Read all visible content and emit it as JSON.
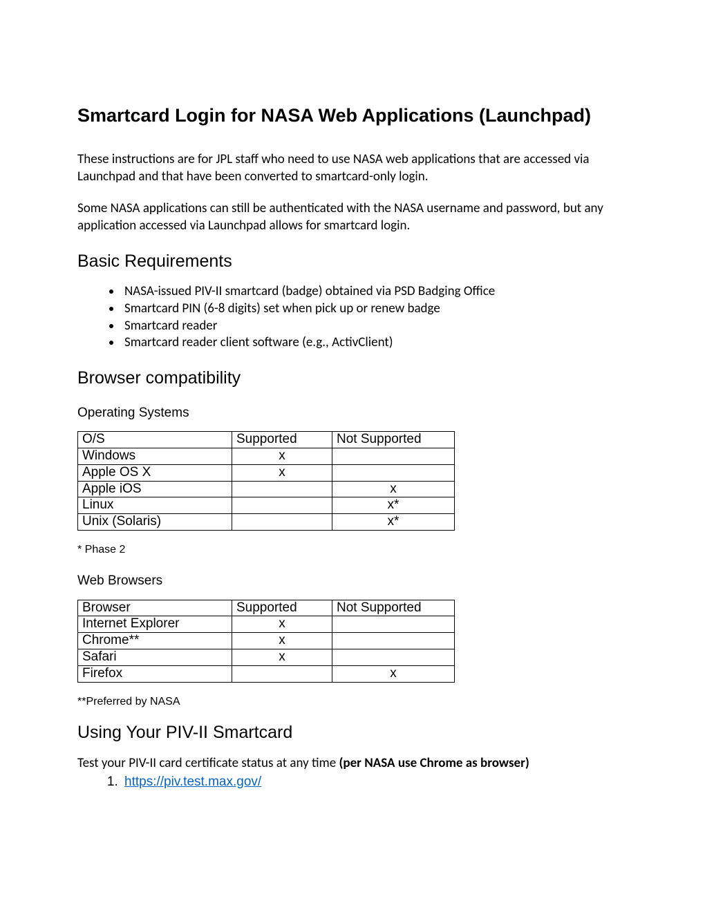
{
  "title": "Smartcard Login for NASA Web Applications (Launchpad)",
  "intro": {
    "p1": "These instructions are for JPL staff who need to use NASA web applications that are accessed via Launchpad and that have been converted to smartcard-only login.",
    "p2": "Some NASA applications can still be authenticated with the NASA username and password, but any application accessed via Launchpad allows for smartcard login."
  },
  "basic": {
    "heading": "Basic Requirements",
    "items": [
      "NASA-issued PIV-II smartcard (badge) obtained via PSD Badging Office",
      "Smartcard PIN (6-8 digits) set when pick up or renew badge",
      "Smartcard reader",
      "Smartcard reader client software (e.g., ActivClient)"
    ]
  },
  "compat": {
    "heading": "Browser compatibility",
    "os": {
      "subheading": "Operating Systems",
      "headers": {
        "c0": "O/S",
        "c1": "Supported",
        "c2": "Not Supported"
      },
      "rows": [
        {
          "name": "Windows",
          "sup": "x",
          "nsup": ""
        },
        {
          "name": "Apple OS X",
          "sup": "x",
          "nsup": ""
        },
        {
          "name": "Apple iOS",
          "sup": "",
          "nsup": "x"
        },
        {
          "name": "Linux",
          "sup": "",
          "nsup": "x*"
        },
        {
          "name": "Unix (Solaris)",
          "sup": "",
          "nsup": "x*"
        }
      ],
      "footnote": "* Phase 2"
    },
    "browsers": {
      "subheading": "Web Browsers",
      "headers": {
        "c0": "Browser",
        "c1": "Supported",
        "c2": "Not Supported"
      },
      "rows": [
        {
          "name": "Internet Explorer",
          "sup": "x",
          "nsup": ""
        },
        {
          "name": "Chrome**",
          "sup": "x",
          "nsup": ""
        },
        {
          "name": "Safari",
          "sup": "x",
          "nsup": ""
        },
        {
          "name": "Firefox",
          "sup": "",
          "nsup": "x"
        }
      ],
      "footnote": "**Preferred by NASA"
    }
  },
  "using": {
    "heading": "Using Your PIV-II Smartcard",
    "lead_pre": "Test your PIV-II card certificate status at any time ",
    "lead_bold": "(per NASA use Chrome as browser)",
    "link_text": "https://piv.test.max.gov/",
    "link_href": "https://piv.test.max.gov/"
  }
}
